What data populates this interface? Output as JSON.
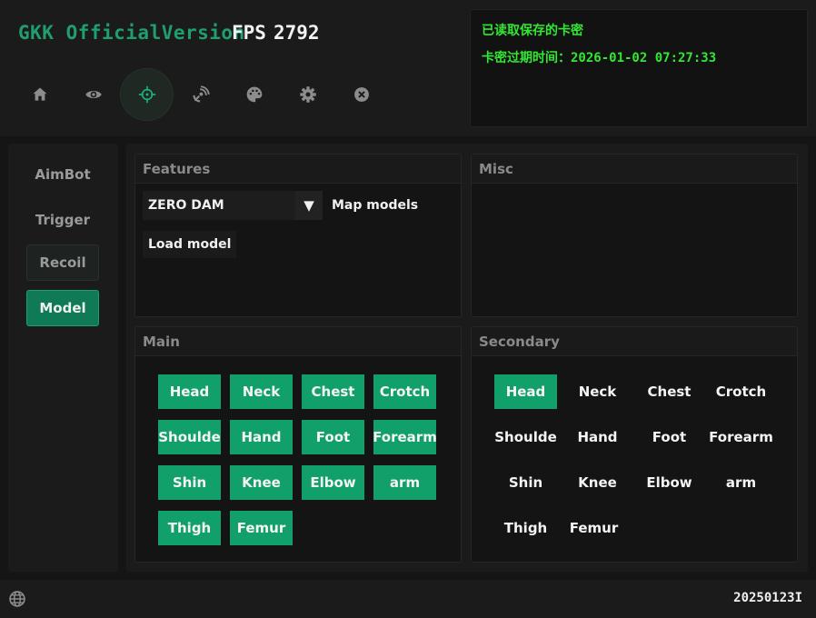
{
  "header": {
    "brand": "GKK OfficialVersion",
    "fps_label": "FPS",
    "fps_value": "2792",
    "license_line1": "已读取保存的卡密",
    "license_line2": "卡密过期时间：2026-01-02 07:27:33"
  },
  "nav_icons": [
    "home-icon",
    "eye-icon",
    "crosshair-icon",
    "satellite-icon",
    "palette-icon",
    "gear-icon",
    "close-circle-icon"
  ],
  "sidebar": {
    "items": [
      {
        "label": "AimBot"
      },
      {
        "label": "Trigger"
      },
      {
        "label": "Recoil"
      },
      {
        "label": "Model"
      }
    ]
  },
  "features": {
    "title": "Features",
    "combo_value": "ZERO DAM",
    "combo_arrow": "▼",
    "map_models": "Map models",
    "load_model": "Load model"
  },
  "misc": {
    "title": "Misc"
  },
  "main_bones": {
    "title": "Main",
    "bones": [
      "Head",
      "Neck",
      "Chest",
      "Crotch",
      "Shoulde",
      "Hand",
      "Foot",
      "Forearm",
      "Shin",
      "Knee",
      "Elbow",
      "arm",
      "Thigh",
      "Femur"
    ]
  },
  "secondary_bones": {
    "title": "Secondary",
    "bones": [
      "Head",
      "Neck",
      "Chest",
      "Crotch",
      "Shoulde",
      "Hand",
      "Foot",
      "Forearm",
      "Shin",
      "Knee",
      "Elbow",
      "arm",
      "Thigh",
      "Femur"
    ]
  },
  "footer": {
    "build": "20250123I"
  },
  "colors": {
    "accent": "#12a06a",
    "brand": "#1f9e6e",
    "license_text": "#33e633"
  }
}
